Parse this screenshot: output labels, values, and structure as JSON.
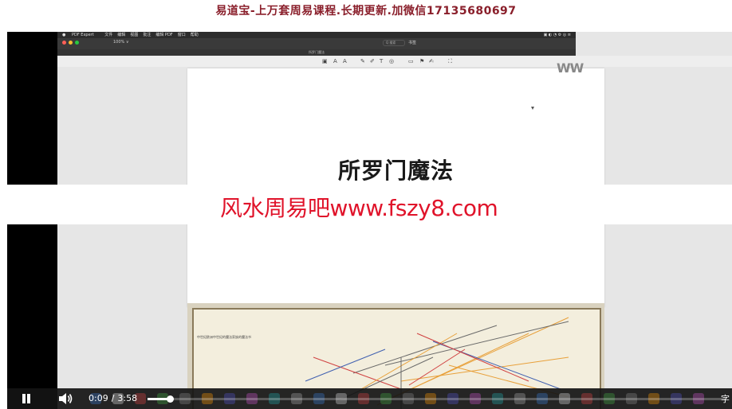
{
  "top_banner": {
    "text": "易道宝-上万套周易课程.长期更新.加微信17135680697"
  },
  "app": {
    "name": "PDF Expert",
    "menu_items": [
      "文件",
      "编辑",
      "视图",
      "批注",
      "编辑 PDF",
      "窗口",
      "帮助"
    ],
    "zoom": "100% ∨",
    "search_placeholder": "Q 搜索",
    "bookmark_label": "书签",
    "document_title": "所罗门魔法"
  },
  "page": {
    "title": "所罗门魔法"
  },
  "watermark_right": {
    "text": "WW"
  },
  "watermark_middle": {
    "text": "风水周易吧www.fszy8.com"
  },
  "diagram": {
    "caption": "中世纪欧洲中世纪的魔法家族的魔法书",
    "background_color": "#f3eedd",
    "line_colors": [
      "#e8a03a",
      "#6a6a6a",
      "#d04040",
      "#4060b0"
    ]
  },
  "player": {
    "current_time": "0:09",
    "separator": "/",
    "duration": "3:58",
    "progress": 0.038,
    "subtitle_label": "字",
    "pause_icon": "pause-icon",
    "volume_icon": "volume-icon"
  },
  "colors": {
    "banner_text": "#8a1f2b",
    "watermark_red": "#e0132a",
    "controls_bg": "#141414"
  }
}
